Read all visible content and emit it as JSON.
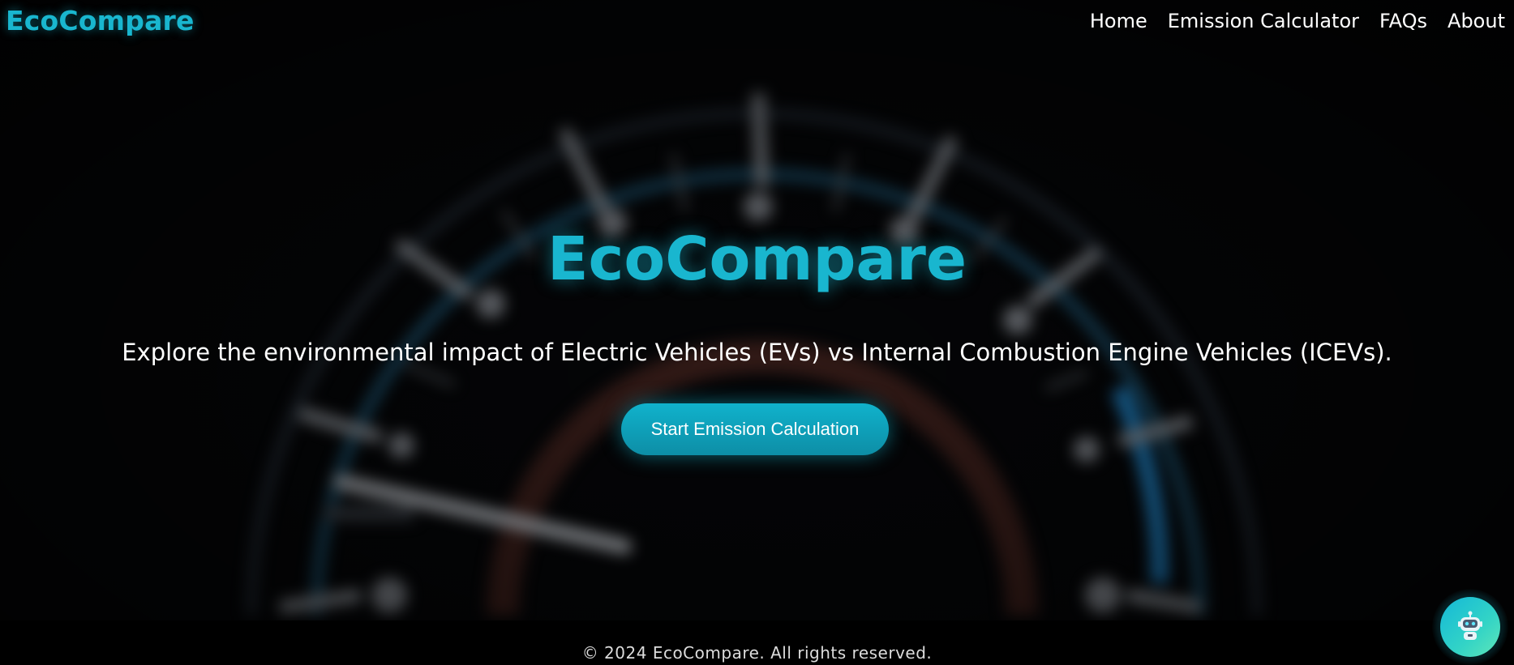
{
  "header": {
    "brand": "EcoCompare",
    "nav": [
      {
        "label": "Home"
      },
      {
        "label": "Emission Calculator"
      },
      {
        "label": "FAQs"
      },
      {
        "label": "About"
      }
    ]
  },
  "hero": {
    "title": "EcoCompare",
    "subtitle": "Explore the environmental impact of Electric Vehicles (EVs) vs Internal Combustion Engine Vehicles (ICEVs).",
    "cta_label": "Start Emission Calculation"
  },
  "footer": {
    "text": "© 2024 EcoCompare. All rights reserved."
  },
  "chatbot": {
    "icon": "robot-icon"
  },
  "colors": {
    "accent": "#19b6cf",
    "background": "#000000",
    "text": "#ffffff"
  }
}
